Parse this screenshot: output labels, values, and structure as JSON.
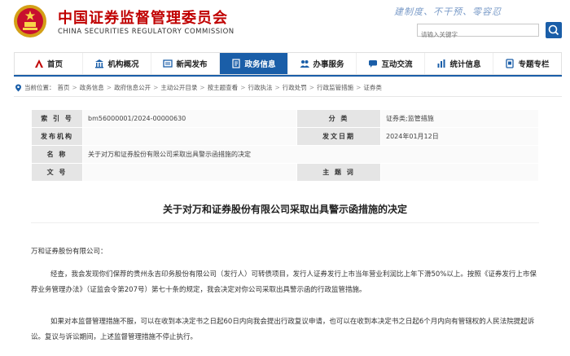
{
  "header": {
    "title_cn": "中国证券监督管理委员会",
    "title_en": "CHINA SECURITIES REGULATORY COMMISSION",
    "slogan": "建制度、不干预、零容忍",
    "search_placeholder": "请输入关键字"
  },
  "nav": {
    "items": [
      {
        "label": "首页",
        "icon": "home-icon"
      },
      {
        "label": "机构概况",
        "icon": "building-icon"
      },
      {
        "label": "新闻发布",
        "icon": "newspaper-icon"
      },
      {
        "label": "政务信息",
        "icon": "document-icon"
      },
      {
        "label": "办事服务",
        "icon": "people-icon"
      },
      {
        "label": "互动交流",
        "icon": "chat-icon"
      },
      {
        "label": "统计信息",
        "icon": "stats-icon"
      },
      {
        "label": "专题专栏",
        "icon": "topic-icon"
      }
    ],
    "active_index": 3,
    "active_color": "#1a5ea8"
  },
  "breadcrumb": {
    "prefix": "当前位置：",
    "items": [
      "首页",
      "政务信息",
      "政府信息公开",
      "主动公开目录",
      "按主题查看",
      "行政执法",
      "行政处罚",
      "行政监管措施",
      "证券类"
    ]
  },
  "info": {
    "index_label": "索 引 号",
    "index_value": "bm56000001/2024-00000630",
    "category_label": "分    类",
    "category_value": "证券类;监管措施",
    "publisher_label": "发布机构",
    "publisher_value": "",
    "date_label": "发文日期",
    "date_value": "2024年01月12日",
    "name_label": "名    称",
    "name_value": "关于对万和证券股份有限公司采取出具警示函措施的决定",
    "docno_label": "文    号",
    "docno_value": "",
    "keywords_label": "主 题 词",
    "keywords_value": ""
  },
  "document": {
    "title": "关于对万和证券股份有限公司采取出具警示函措施的决定",
    "salutation": "万和证券股份有限公司：",
    "para1": "经查，我会发现你们保荐的贵州永吉印务股份有限公司（发行人）可转债项目，发行人证券发行上市当年营业利润比上年下滑50%以上。按照《证券发行上市保荐业务管理办法》（证监会令第207号）第七十条的规定，我会决定对你公司采取出具警示函的行政监管措施。",
    "para2": "如果对本监督管理措施不服，可以在收到本决定书之日起60日内向我会提出行政复议申请，也可以在收到本决定书之日起6个月内向有管辖权的人民法院提起诉讼。复议与诉讼期间，上述监督管理措施不停止执行。"
  },
  "colors": {
    "brand_red": "#c00000",
    "brand_blue": "#1a5ea8"
  }
}
